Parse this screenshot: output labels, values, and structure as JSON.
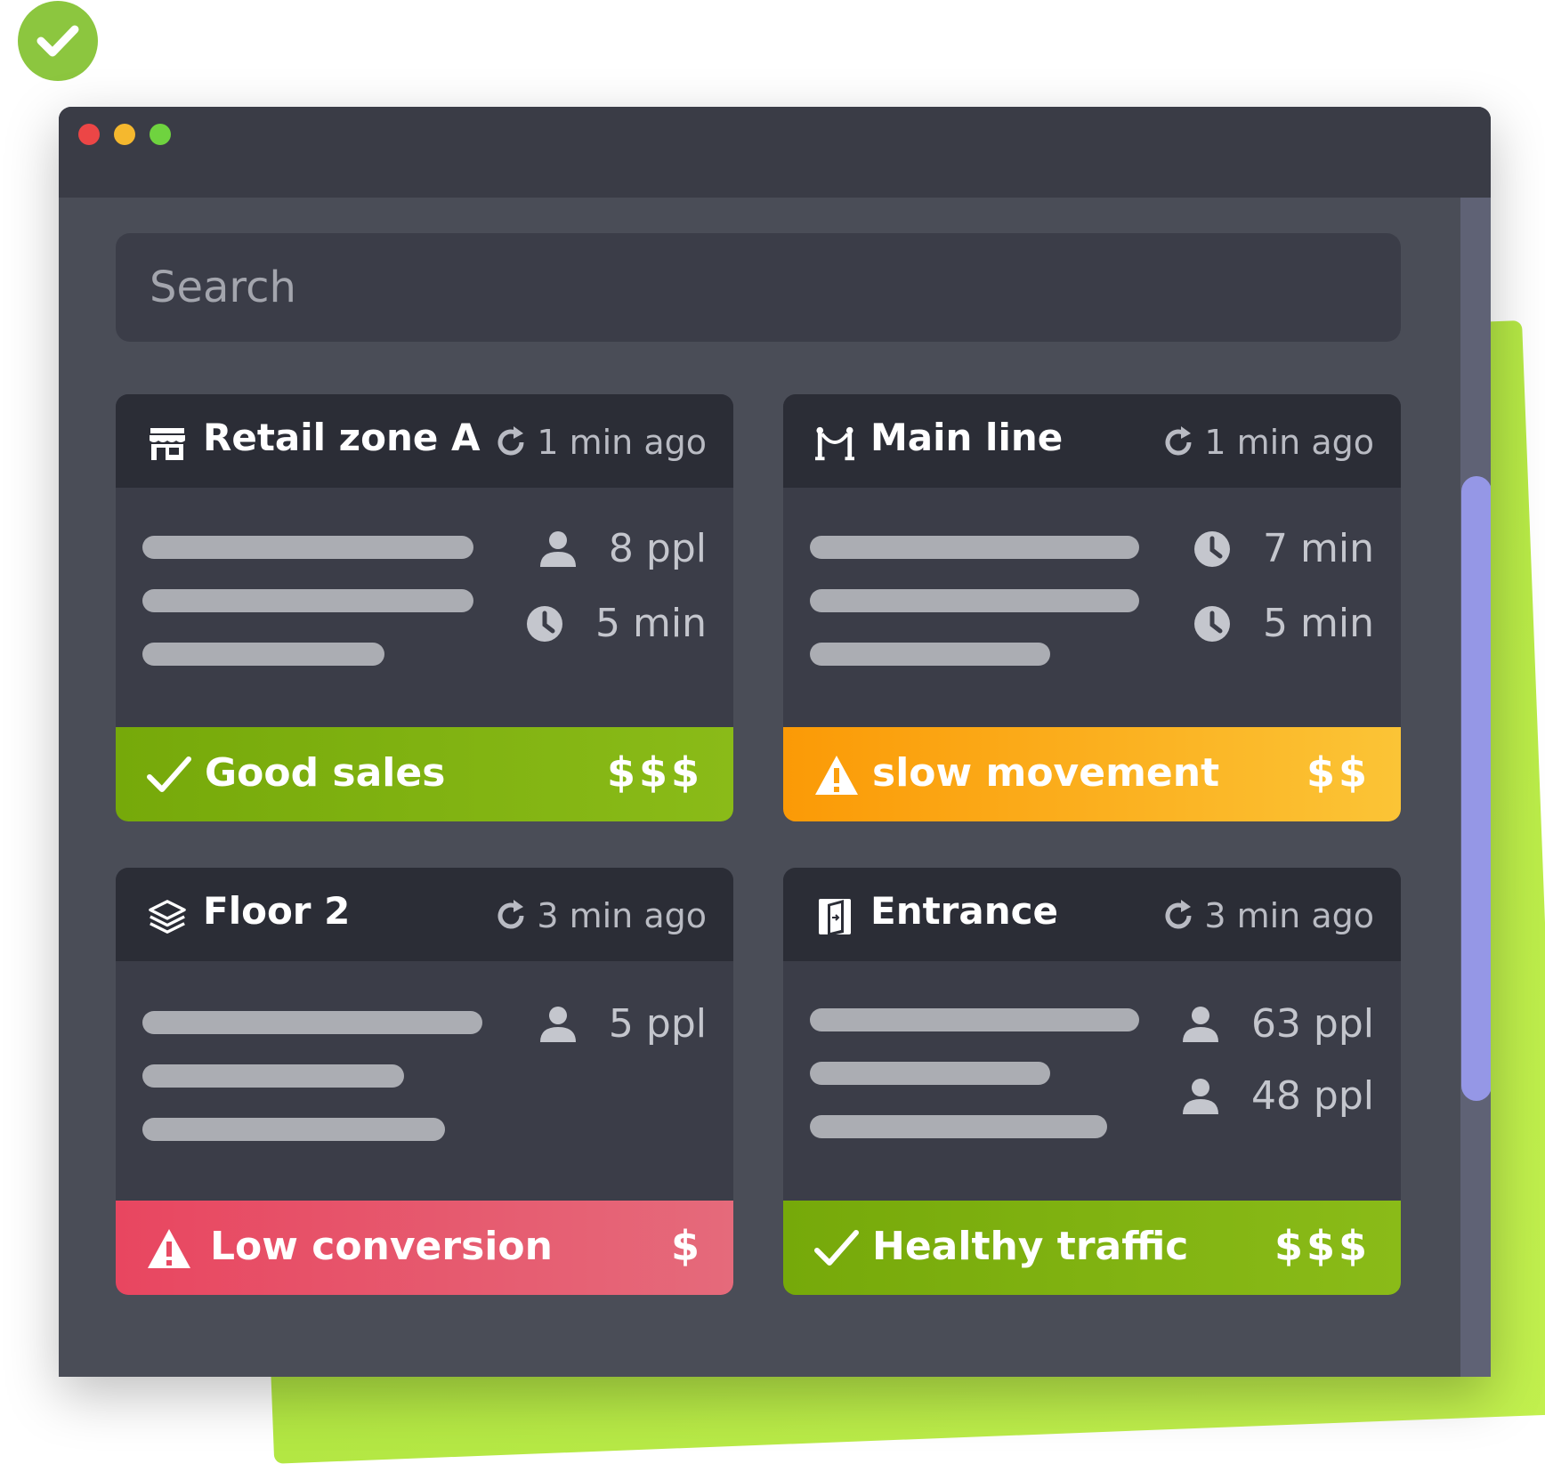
{
  "search": {
    "placeholder": "Search"
  },
  "cards": [
    {
      "title": "Retail zone A",
      "icon": "store-icon",
      "updated": "1 min ago",
      "stats": [
        {
          "icon": "person-icon",
          "value": "8 ppl"
        },
        {
          "icon": "clock-icon",
          "value": "5 min"
        }
      ],
      "status": {
        "icon": "check-icon",
        "label": "Good sales",
        "price": "$$$",
        "color": "#7db311"
      }
    },
    {
      "title": "Main line",
      "icon": "queue-barrier-icon",
      "updated": "1 min ago",
      "stats": [
        {
          "icon": "clock-icon",
          "value": "7 min"
        },
        {
          "icon": "clock-icon",
          "value": "5 min"
        }
      ],
      "status": {
        "icon": "warning-icon",
        "label": "slow movement",
        "price": "$$",
        "color": "#fbac1c"
      }
    },
    {
      "title": "Floor 2",
      "icon": "layers-icon",
      "updated": "3 min ago",
      "stats": [
        {
          "icon": "person-icon",
          "value": "5 ppl"
        }
      ],
      "status": {
        "icon": "warning-icon",
        "label": "Low conversion",
        "price": "$",
        "color": "#e7566c"
      }
    },
    {
      "title": "Entrance",
      "icon": "door-icon",
      "updated": "3 min ago",
      "stats": [
        {
          "icon": "person-icon",
          "value": "63 ppl"
        },
        {
          "icon": "person-icon",
          "value": "48 ppl"
        }
      ],
      "status": {
        "icon": "check-icon",
        "label": "Healthy traffic",
        "price": "$$$",
        "color": "#7db311"
      }
    }
  ]
}
